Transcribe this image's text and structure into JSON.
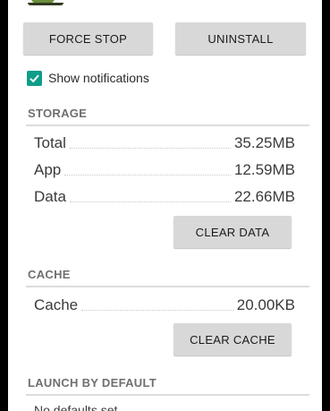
{
  "actions": {
    "force_stop": "FORCE STOP",
    "uninstall": "UNINSTALL"
  },
  "notifications": {
    "label": "Show notifications",
    "checked": true
  },
  "storage": {
    "header": "STORAGE",
    "rows": [
      {
        "label": "Total",
        "value": "35.25MB"
      },
      {
        "label": "App",
        "value": "12.59MB"
      },
      {
        "label": "Data",
        "value": "22.66MB"
      }
    ],
    "clear_data": "CLEAR DATA"
  },
  "cache": {
    "header": "CACHE",
    "rows": [
      {
        "label": "Cache",
        "value": "20.00KB"
      }
    ],
    "clear_cache": "CLEAR CACHE"
  },
  "launch": {
    "header": "LAUNCH BY DEFAULT",
    "status": "No defaults set."
  },
  "icons": {
    "app": "android-robot-icon",
    "checkbox": "check-icon"
  },
  "colors": {
    "accent": "#0f9d8a",
    "button": "#d8d8d8",
    "section_header": "#6f6f6f"
  }
}
